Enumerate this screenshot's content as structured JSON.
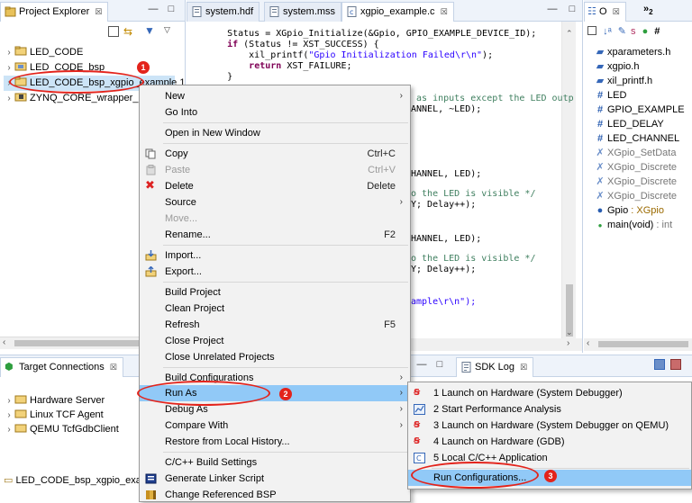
{
  "project_explorer": {
    "tab_label": "Project Explorer",
    "tab_close": "☒",
    "items": [
      {
        "label": "LED_CODE"
      },
      {
        "label": "LED_CODE_bsp"
      },
      {
        "label": "LED_CODE_bsp_xgpio_example 1"
      },
      {
        "label": "ZYNQ_CORE_wrapper_hw"
      }
    ]
  },
  "editor": {
    "tabs": [
      {
        "label": "system.hdf"
      },
      {
        "label": "system.mss"
      },
      {
        "label": "xgpio_example.c",
        "close": "☒"
      }
    ],
    "lines": [
      {
        "a": "    Status = XGpio_Initialize(&Gpio, GPIO_EXAMPLE_DEVICE_ID);"
      },
      {
        "a": "    ",
        "k": "if",
        "b": " (Status != XST_SUCCESS) {"
      },
      {
        "a": "        xil_printf(",
        "s": "\"Gpio Initialization Failed\\r\\n\"",
        "b": ");"
      },
      {
        "a": "        ",
        "k": "return",
        "b": " XST_FAILURE;"
      },
      {
        "a": "    }"
      }
    ],
    "fragments": [
      {
        "a": " as inputs except the LED outp"
      },
      {
        "a": "ANNEL, ~LED);"
      },
      {
        "a": "HANNEL, LED);"
      },
      {
        "a": "o the LED is visible */"
      },
      {
        "a": "Y; Delay++);"
      },
      {
        "a": "HANNEL, LED);"
      },
      {
        "a": "o the LED is visible */"
      },
      {
        "a": "Y; Delay++);"
      },
      {
        "a": "ample\\r\\n\");"
      }
    ]
  },
  "outline": {
    "tab_label": "O",
    "tab_close": "☒",
    "overflow": "»",
    "overflow_count": "2",
    "items": [
      {
        "kind": "include",
        "label": "xparameters.h"
      },
      {
        "kind": "include",
        "label": "xgpio.h"
      },
      {
        "kind": "include",
        "label": "xil_printf.h"
      },
      {
        "kind": "define",
        "label": "LED"
      },
      {
        "kind": "define",
        "label": "GPIO_EXAMPLE"
      },
      {
        "kind": "define",
        "label": "LED_DELAY"
      },
      {
        "kind": "define",
        "label": "LED_CHANNEL"
      },
      {
        "kind": "macro",
        "label": "XGpio_SetData"
      },
      {
        "kind": "macro",
        "label": "XGpio_Discrete"
      },
      {
        "kind": "macro",
        "label": "XGpio_Discrete"
      },
      {
        "kind": "macro",
        "label": "XGpio_Discrete"
      },
      {
        "kind": "var",
        "label": "Gpio",
        "type": " : XGpio"
      },
      {
        "kind": "func",
        "label": "main(void)",
        "type": " : int"
      }
    ]
  },
  "target_connections": {
    "tab_label": "Target Connections",
    "tab_close": "☒",
    "items": [
      {
        "label": "Hardware Server"
      },
      {
        "label": "Linux TCF Agent"
      },
      {
        "label": "QEMU TcfGdbClient"
      }
    ]
  },
  "sdk_log": {
    "tab_label": "SDK Log",
    "tab_close": "☒"
  },
  "status_bar": {
    "label": "LED_CODE_bsp_xgpio_examp"
  },
  "context_menu": {
    "items": [
      {
        "label": "New",
        "sub": "›"
      },
      {
        "label": "Go Into"
      },
      {
        "label": "Open in New Window"
      },
      {
        "label": "Copy",
        "shortcut": "Ctrl+C"
      },
      {
        "label": "Paste",
        "shortcut": "Ctrl+V"
      },
      {
        "label": "Delete",
        "shortcut": "Delete"
      },
      {
        "label": "Source",
        "sub": "›"
      },
      {
        "label": "Move..."
      },
      {
        "label": "Rename...",
        "shortcut": "F2"
      },
      {
        "label": "Import..."
      },
      {
        "label": "Export..."
      },
      {
        "label": "Build Project"
      },
      {
        "label": "Clean Project"
      },
      {
        "label": "Refresh",
        "shortcut": "F5"
      },
      {
        "label": "Close Project"
      },
      {
        "label": "Close Unrelated Projects"
      },
      {
        "label": "Build Configurations",
        "sub": "›"
      },
      {
        "label": "Run As",
        "sub": "›"
      },
      {
        "label": "Debug As",
        "sub": "›"
      },
      {
        "label": "Compare With",
        "sub": "›"
      },
      {
        "label": "Restore from Local History..."
      },
      {
        "label": "C/C++ Build Settings"
      },
      {
        "label": "Generate Linker Script"
      },
      {
        "label": "Change Referenced BSP"
      }
    ]
  },
  "run_as_submenu": {
    "items": [
      {
        "label": "1 Launch on Hardware (System Debugger)"
      },
      {
        "label": "2 Start Performance Analysis"
      },
      {
        "label": "3 Launch on Hardware (System Debugger on QEMU)"
      },
      {
        "label": "4 Launch on Hardware (GDB)"
      },
      {
        "label": "5 Local C/C++ Application"
      },
      {
        "label": "Run Configurations..."
      }
    ]
  },
  "annotations": {
    "badge1": "1",
    "badge2": "2",
    "badge3": "3"
  },
  "colors": {
    "highlight": "#91c9f7",
    "annotation_red": "#e3231b",
    "keyword": "#7f0055",
    "string": "#2a00ff"
  }
}
